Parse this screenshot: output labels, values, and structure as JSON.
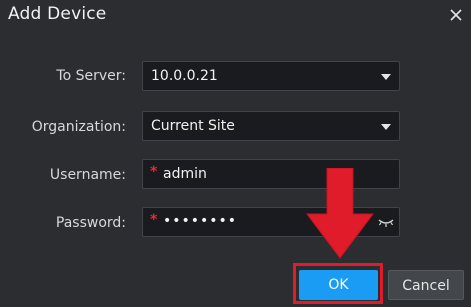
{
  "dialog": {
    "title": "Add Device"
  },
  "form": {
    "server_label": "To Server:",
    "server_value": "10.0.0.21",
    "org_label": "Organization:",
    "org_value": "Current Site",
    "username_label": "Username:",
    "username_value": "admin",
    "password_label": "Password:",
    "password_masked": "••••••••",
    "required_mark": "*"
  },
  "buttons": {
    "ok_label": "OK",
    "cancel_label": "Cancel"
  },
  "annotation": {
    "color": "#e01c2a"
  },
  "colors": {
    "accent": "#1a9cf5",
    "background": "#2b2d31",
    "field_bg": "#1a1b1e"
  }
}
